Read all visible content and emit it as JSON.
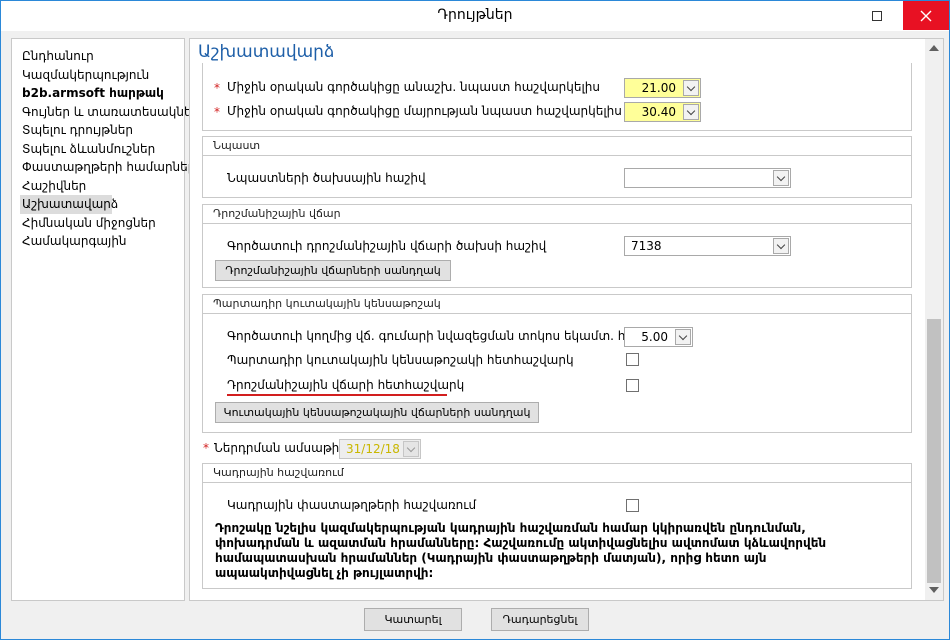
{
  "window": {
    "title": "Դրույթներ"
  },
  "nav": {
    "items": [
      {
        "label": "Ընդհանուր"
      },
      {
        "label": "Կազմակերպություն"
      },
      {
        "label": "b2b.armsoft հարթակ"
      },
      {
        "label": "Գույներ և տառատեսակներ"
      },
      {
        "label": "Տպելու դրույթներ"
      },
      {
        "label": "Տպելու ձևանմուշներ"
      },
      {
        "label": "Փաստաթղթերի համարներ"
      },
      {
        "label": "Հաշիվներ"
      },
      {
        "label": "Աշխատավարձ"
      },
      {
        "label": "Հիմնական միջոցներ"
      },
      {
        "label": "Համակարգային"
      }
    ],
    "selected_index": 8
  },
  "main": {
    "title": "Աշխատավարձ",
    "top": {
      "row1": {
        "label": "Միջին օրական գործակիցը անաշխ. նպաստ հաշվարկելիս",
        "value": "21.00"
      },
      "row2": {
        "label": "Միջին օրական գործակիցը մայրության նպաստ հաշվարկելիս",
        "value": "30.40"
      }
    },
    "benefit": {
      "header": "Նպաստ",
      "account_label": "Նպաստների ծախսային հաշիվ",
      "account_value": ""
    },
    "bonus": {
      "header": "Դրոշմանիշային վճար",
      "account_label": "Գործատուի դրոշմանիշային վճարի ծախսի հաշիվ",
      "account_value": "7138",
      "settings_button": "Դրոշմանիշային վճարների սանդղակ"
    },
    "pension": {
      "header": "Պարտադիր կուտակային կենսաթոշակ",
      "pct_label": "Գործատուի կողմից վճ. գումարի նվազեցման տոկոս եկամտ. հարկից",
      "pct_value": "5.00",
      "track_label": "Պարտադիր կուտակային կենսաթոշակի հետհաշվարկ",
      "stamp_label": "Դրոշմանիշային վճարի հետհաշվարկ",
      "scale_button": "Կուտակային կենսաթոշակային վճարների սանդղակ"
    },
    "entry_date": {
      "label": "Ներդրման ամսաթիվ",
      "value": "31/12/18"
    },
    "personnel": {
      "header": "Կադրային հաշվառում",
      "docs_label": "Կադրային փաստաթղթերի հաշվառում",
      "note": "Դրոշակը նշելիս կազմակերպության կադրային հաշվառման համար կկիրառվեն ընդունման, փոխադրման և ազատման հրամանները: Հաշվառումը ակտիվացնելիս ավտոմատ կձևավորվեն համապատասխան հրամաններ (Կադրային փաստաթղթերի մատյան), որից հետո այն ապաակտիվացնել չի թույլատրվի:"
    }
  },
  "footer": {
    "ok": "Կատարել",
    "cancel": "Դադարեցնել"
  },
  "colors": {
    "title_blue": "#1e5fa8",
    "required_red": "#d21e1e",
    "highlight_yellow": "#ffff99",
    "close_red": "#e81123"
  }
}
